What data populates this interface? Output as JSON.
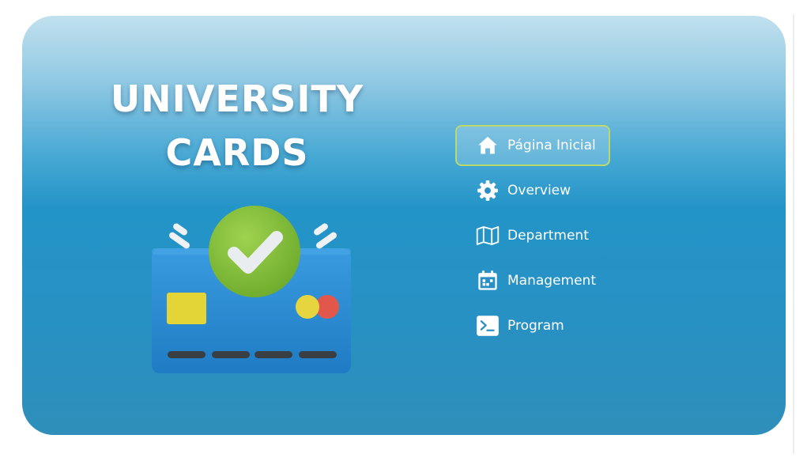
{
  "hero": {
    "title_line1": "UNIVERSITY",
    "title_line2": "CARDS"
  },
  "nav": {
    "items": [
      {
        "label": "Página Inicial",
        "icon": "home-icon",
        "active": true
      },
      {
        "label": "Overview",
        "icon": "gear-icon",
        "active": false
      },
      {
        "label": "Department",
        "icon": "map-icon",
        "active": false
      },
      {
        "label": "Management",
        "icon": "calendar-icon",
        "active": false
      },
      {
        "label": "Program",
        "icon": "terminal-icon",
        "active": false
      }
    ]
  },
  "colors": {
    "panel_top": "#c1e1ee",
    "panel_mid": "#2394c8",
    "active_border": "#b9d96a",
    "card_blue": "#2b8fd6",
    "check_green": "#8cc63f",
    "chip_yellow": "#e3d437",
    "logo_red": "#e2574c"
  }
}
